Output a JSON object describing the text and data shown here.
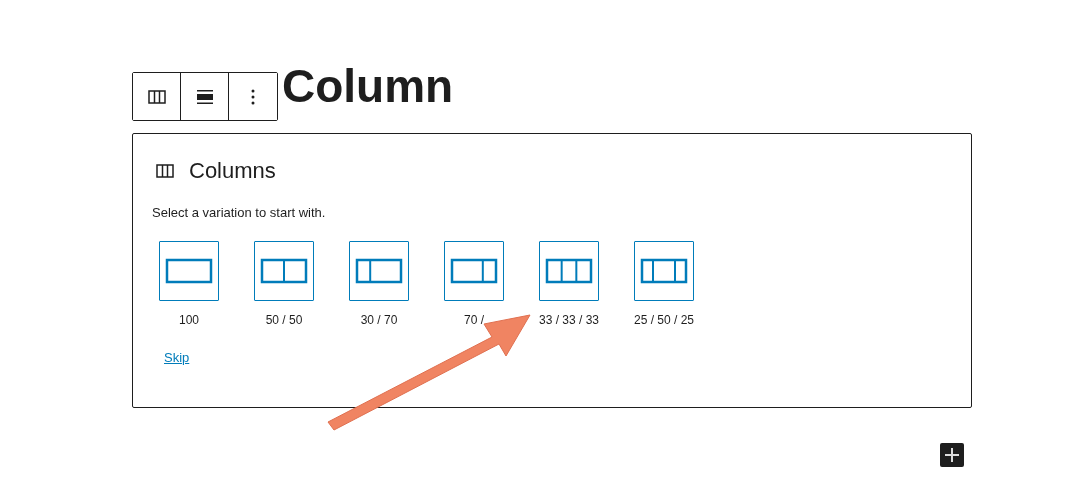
{
  "heading": "Column",
  "toolbar": [
    {
      "kind": "columns"
    },
    {
      "kind": "align"
    },
    {
      "kind": "more"
    }
  ],
  "placeholder": {
    "title": "Columns",
    "instructions": "Select a variation to start with.",
    "variations": [
      {
        "label": "100",
        "kind": "full"
      },
      {
        "label": "50 / 50",
        "kind": "halves"
      },
      {
        "label": "30 / 70",
        "kind": "narrow-wide"
      },
      {
        "label": "70 /",
        "kind": "wide-narrow"
      },
      {
        "label": "33 / 33 / 33",
        "kind": "thirds"
      },
      {
        "label": "25 / 50 / 25",
        "kind": "wide-center"
      }
    ],
    "skip": "Skip"
  }
}
